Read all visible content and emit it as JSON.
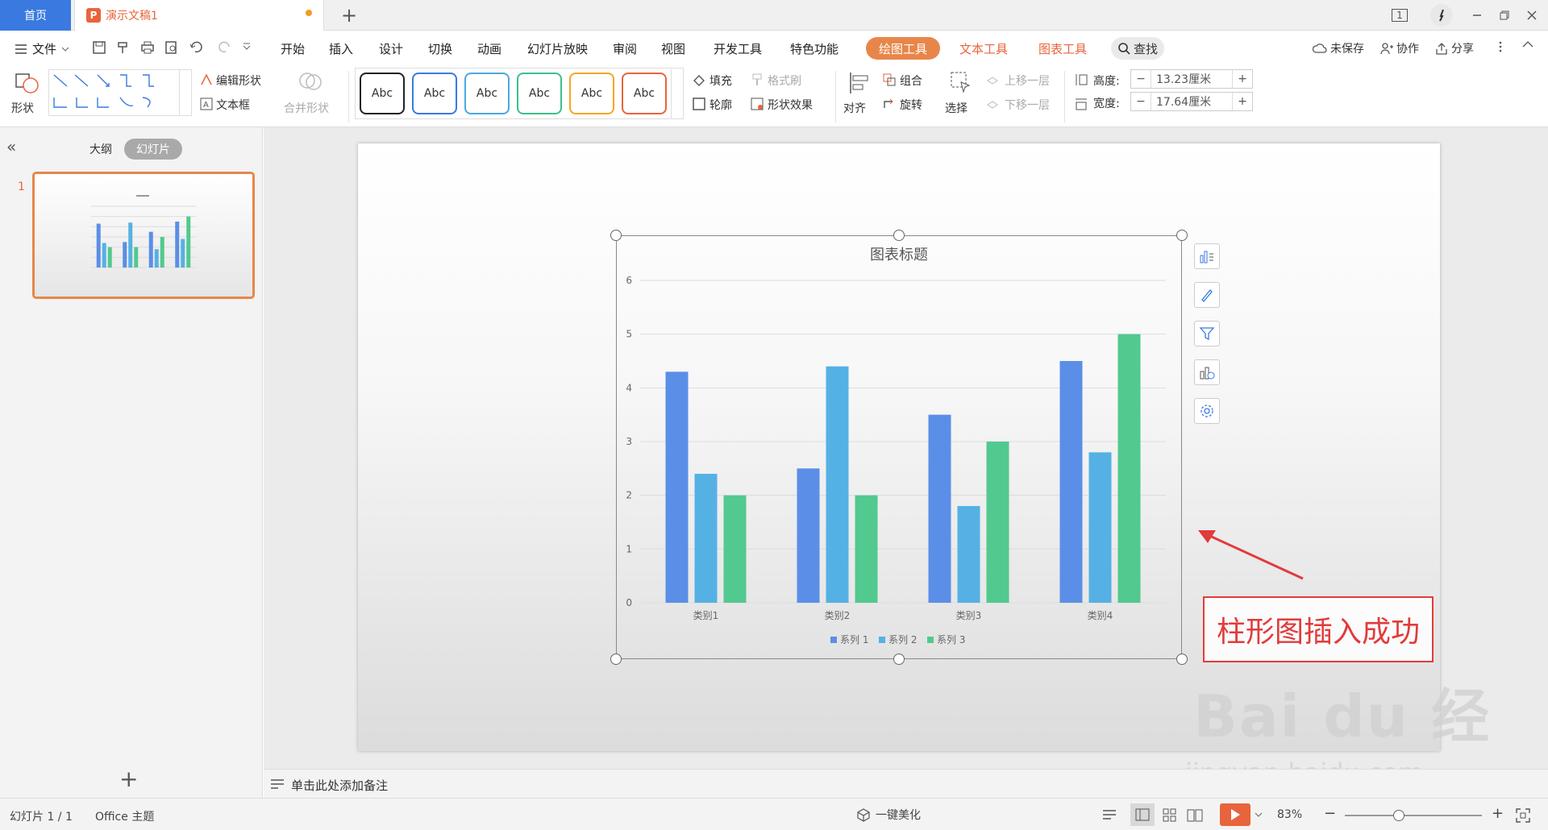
{
  "titlebar": {
    "home_tab": "首页",
    "doc_tab": "演示文稿1",
    "doc_badge": "P",
    "add_tab": "+",
    "page_indicator": "1"
  },
  "menubar": {
    "file": "文件",
    "items": [
      "开始",
      "插入",
      "设计",
      "切换",
      "动画",
      "幻灯片放映",
      "审阅",
      "视图",
      "开发工具",
      "特色功能"
    ],
    "drawing_tools": "绘图工具",
    "text_tools": "文本工具",
    "chart_tools": "图表工具",
    "search": "查找",
    "unsaved": "未保存",
    "collab": "协作",
    "share": "分享"
  },
  "ribbon": {
    "shape": "形状",
    "edit_shape": "编辑形状",
    "text_box": "文本框",
    "merge_shape": "合并形状",
    "style_samples": [
      "Abc",
      "Abc",
      "Abc",
      "Abc",
      "Abc",
      "Abc"
    ],
    "style_colors": [
      "#222222",
      "#3a7ae0",
      "#4aa8e0",
      "#3cc08a",
      "#f5a623",
      "#e8643c"
    ],
    "fill": "填充",
    "format_brush": "格式刷",
    "outline": "轮廓",
    "shape_effect": "形状效果",
    "align": "对齐",
    "group": "组合",
    "rotate": "旋转",
    "select": "选择",
    "bring_forward": "上移一层",
    "send_backward": "下移一层",
    "height_label": "高度:",
    "height_value": "13.23厘米",
    "width_label": "宽度:",
    "width_value": "17.64厘米",
    "minus": "−",
    "plus": "+"
  },
  "leftpane": {
    "outline_tab": "大纲",
    "slides_tab": "幻灯片",
    "slide_number": "1",
    "add": "+"
  },
  "chart_data": {
    "type": "bar",
    "title": "图表标题",
    "categories": [
      "类别1",
      "类别2",
      "类别3",
      "类别4"
    ],
    "series": [
      {
        "name": "系列 1",
        "values": [
          4.3,
          2.5,
          3.5,
          4.5
        ],
        "color": "#5b8ee6"
      },
      {
        "name": "系列 2",
        "values": [
          2.4,
          4.4,
          1.8,
          2.8
        ],
        "color": "#55b1e4"
      },
      {
        "name": "系列 3",
        "values": [
          2,
          2,
          3,
          5
        ],
        "color": "#52c98e"
      }
    ],
    "ylim": [
      0,
      6
    ],
    "yticks": [
      "0",
      "1",
      "2",
      "3",
      "4",
      "5",
      "6"
    ],
    "grid": true,
    "legend": "bottom"
  },
  "notes": {
    "placeholder": "单击此处添加备注"
  },
  "statusbar": {
    "slide_info": "幻灯片 1 / 1",
    "theme": "Office 主题",
    "beautify": "一键美化",
    "zoom": "83%",
    "minus": "−",
    "plus": "+"
  },
  "annotation": {
    "text": "柱形图插入成功",
    "arrow_color": "#e23b3b"
  },
  "watermark": {
    "brand": "Bai du 经验",
    "url": "jingyan.baidu.com"
  }
}
